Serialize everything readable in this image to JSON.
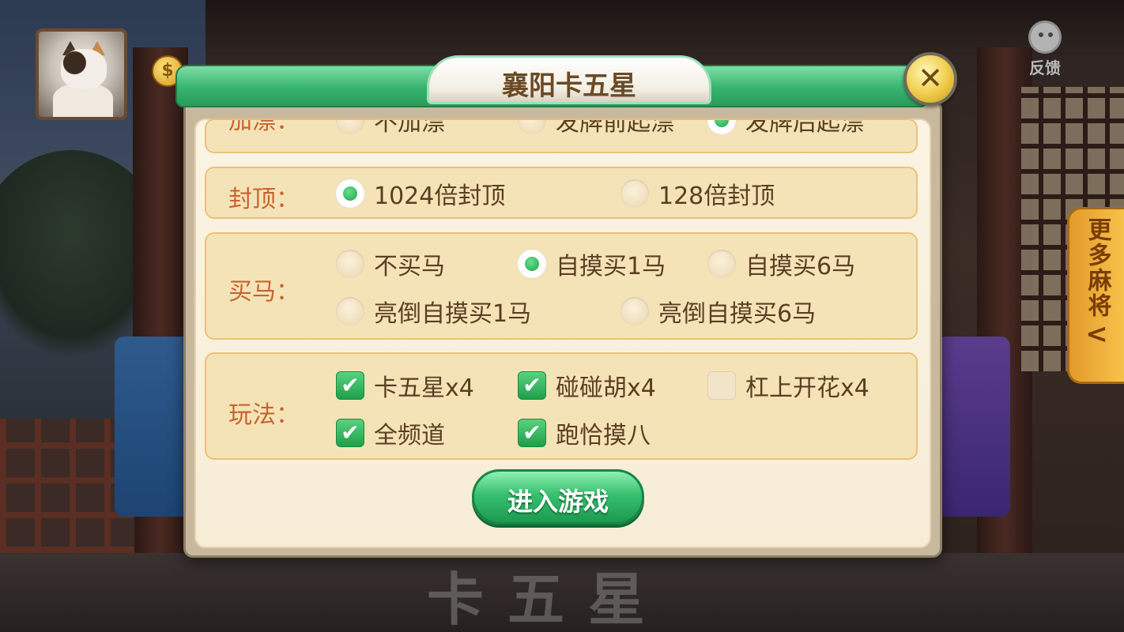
{
  "feedback": {
    "label": "反馈"
  },
  "side_tab": {
    "label": "更多麻将",
    "arrow": "<"
  },
  "coin": {
    "symbol": "$"
  },
  "dialog": {
    "title": "襄阳卡五星",
    "close_symbol": "✕",
    "groups": {
      "jiapiao": {
        "label": "加漂：",
        "options": [
          {
            "label": "不加漂",
            "selected": false
          },
          {
            "label": "发牌前起漂",
            "selected": false
          },
          {
            "label": "发牌后起漂",
            "selected": true
          }
        ]
      },
      "fengding": {
        "label": "封顶：",
        "options": [
          {
            "label": "1024倍封顶",
            "selected": true
          },
          {
            "label": "128倍封顶",
            "selected": false
          }
        ]
      },
      "maima": {
        "label": "买马：",
        "options": [
          {
            "label": "不买马",
            "selected": false
          },
          {
            "label": "自摸买1马",
            "selected": true
          },
          {
            "label": "自摸买6马",
            "selected": false
          },
          {
            "label": "亮倒自摸买1马",
            "selected": false
          },
          {
            "label": "亮倒自摸买6马",
            "selected": false
          }
        ]
      },
      "wanfa": {
        "label": "玩法：",
        "options": [
          {
            "label": "卡五星x4",
            "checked": true
          },
          {
            "label": "碰碰胡x4",
            "checked": true
          },
          {
            "label": "杠上开花x4",
            "checked": false
          },
          {
            "label": "全频道",
            "checked": true
          },
          {
            "label": "跑恰摸八",
            "checked": true
          }
        ]
      }
    },
    "enter_button": "进入游戏",
    "check_mark": "✔"
  },
  "background": {
    "watermark": "卡五星"
  },
  "colors": {
    "title_bar": "#36b46e",
    "accent_green": "#1ea34c",
    "label_orange": "#c6642e",
    "text_brown": "#5a3e22",
    "panel": "#f5e3b8"
  }
}
